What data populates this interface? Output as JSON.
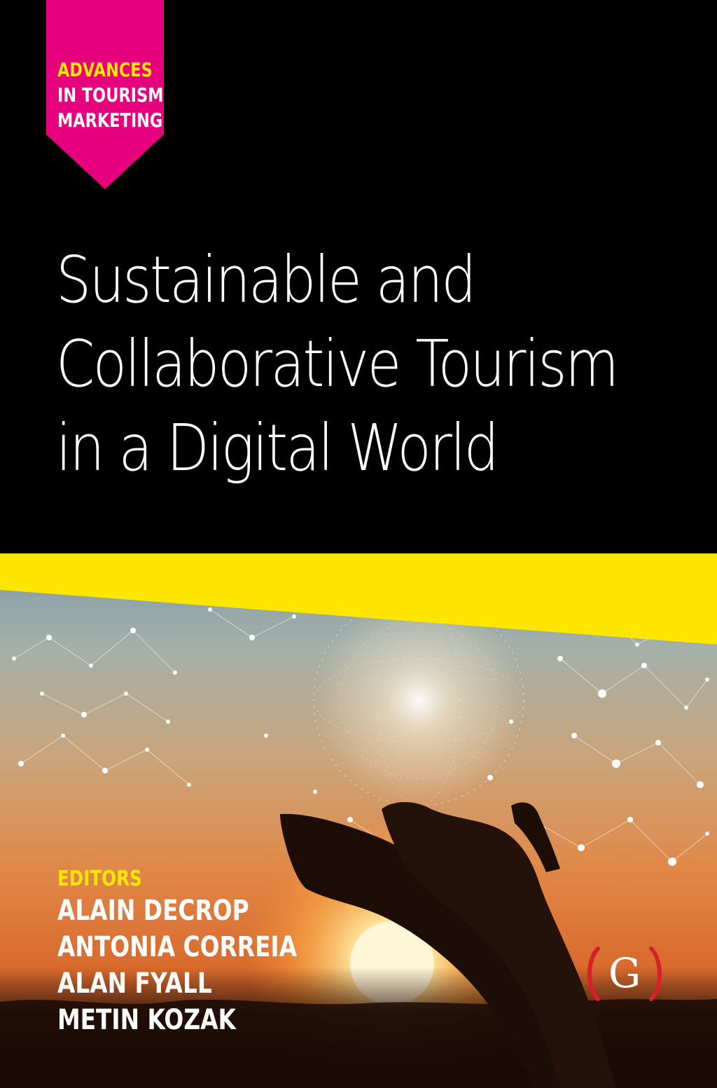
{
  "series": {
    "line1": "ADVANCES",
    "line2": "IN TOURISM",
    "line3": "MARKETING"
  },
  "title": {
    "line1": "Sustainable and",
    "line2": "Collaborative Tourism",
    "line3": "in a Digital World"
  },
  "editors": {
    "label": "EDITORS",
    "names": [
      "ALAIN DECROP",
      "ANTONIA CORREIA",
      "ALAN FYALL",
      "METIN KOZAK"
    ]
  },
  "publisher": {
    "logo_letter": "G"
  },
  "colors": {
    "background": "#000000",
    "accent_yellow": "#ffe600",
    "badge_magenta": "#e6007e",
    "logo_red": "#d8202a"
  },
  "image": {
    "description_icon": "hands-holding-network-globe-sunset"
  }
}
